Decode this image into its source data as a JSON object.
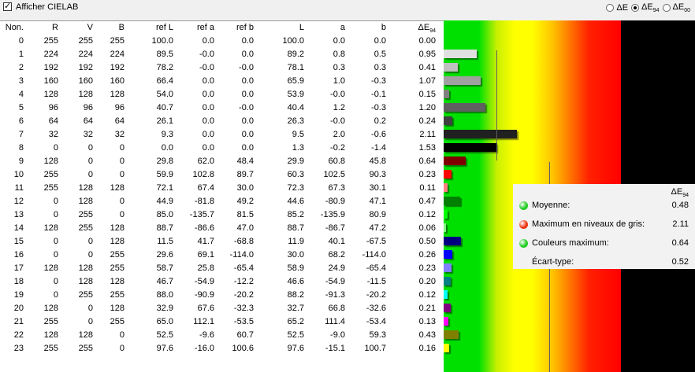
{
  "header": {
    "checkbox_label": "Afficher CIELAB",
    "checkbox_checked": true,
    "radios": [
      {
        "label": "ΔE",
        "checked": false
      },
      {
        "label": "ΔE94",
        "checked": true
      },
      {
        "label": "ΔE00",
        "checked": false
      }
    ]
  },
  "table": {
    "columns": [
      "Non.",
      "R",
      "V",
      "B",
      "ref L",
      "ref a",
      "ref b",
      "L",
      "a",
      "b",
      "ΔE94"
    ],
    "rows": [
      [
        "0",
        "255",
        "255",
        "255",
        "100.0",
        "0.0",
        "0.0",
        "100.0",
        "0.0",
        "0.0",
        "0.00"
      ],
      [
        "1",
        "224",
        "224",
        "224",
        "89.5",
        "-0.0",
        "0.0",
        "89.2",
        "0.8",
        "0.5",
        "0.95"
      ],
      [
        "2",
        "192",
        "192",
        "192",
        "78.2",
        "-0.0",
        "-0.0",
        "78.1",
        "0.3",
        "0.3",
        "0.41"
      ],
      [
        "3",
        "160",
        "160",
        "160",
        "66.4",
        "0.0",
        "0.0",
        "65.9",
        "1.0",
        "-0.3",
        "1.07"
      ],
      [
        "4",
        "128",
        "128",
        "128",
        "54.0",
        "0.0",
        "0.0",
        "53.9",
        "-0.0",
        "-0.1",
        "0.15"
      ],
      [
        "5",
        "96",
        "96",
        "96",
        "40.7",
        "0.0",
        "-0.0",
        "40.4",
        "1.2",
        "-0.3",
        "1.20"
      ],
      [
        "6",
        "64",
        "64",
        "64",
        "26.1",
        "0.0",
        "0.0",
        "26.3",
        "-0.0",
        "0.2",
        "0.24"
      ],
      [
        "7",
        "32",
        "32",
        "32",
        "9.3",
        "0.0",
        "0.0",
        "9.5",
        "2.0",
        "-0.6",
        "2.11"
      ],
      [
        "8",
        "0",
        "0",
        "0",
        "0.0",
        "0.0",
        "0.0",
        "1.3",
        "-0.2",
        "-1.4",
        "1.53"
      ],
      [
        "9",
        "128",
        "0",
        "0",
        "29.8",
        "62.0",
        "48.4",
        "29.9",
        "60.8",
        "45.8",
        "0.64"
      ],
      [
        "10",
        "255",
        "0",
        "0",
        "59.9",
        "102.8",
        "89.7",
        "60.3",
        "102.5",
        "90.3",
        "0.23"
      ],
      [
        "11",
        "255",
        "128",
        "128",
        "72.1",
        "67.4",
        "30.0",
        "72.3",
        "67.3",
        "30.1",
        "0.11"
      ],
      [
        "12",
        "0",
        "128",
        "0",
        "44.9",
        "-81.8",
        "49.2",
        "44.6",
        "-80.9",
        "47.1",
        "0.47"
      ],
      [
        "13",
        "0",
        "255",
        "0",
        "85.0",
        "-135.7",
        "81.5",
        "85.2",
        "-135.9",
        "80.9",
        "0.12"
      ],
      [
        "14",
        "128",
        "255",
        "128",
        "88.7",
        "-86.6",
        "47.0",
        "88.7",
        "-86.7",
        "47.2",
        "0.06"
      ],
      [
        "15",
        "0",
        "0",
        "128",
        "11.5",
        "41.7",
        "-68.8",
        "11.9",
        "40.1",
        "-67.5",
        "0.50"
      ],
      [
        "16",
        "0",
        "0",
        "255",
        "29.6",
        "69.1",
        "-114.0",
        "30.0",
        "68.2",
        "-114.0",
        "0.26"
      ],
      [
        "17",
        "128",
        "128",
        "255",
        "58.7",
        "25.8",
        "-65.4",
        "58.9",
        "24.9",
        "-65.4",
        "0.23"
      ],
      [
        "18",
        "0",
        "128",
        "128",
        "46.7",
        "-54.9",
        "-12.2",
        "46.6",
        "-54.9",
        "-11.5",
        "0.20"
      ],
      [
        "19",
        "0",
        "255",
        "255",
        "88.0",
        "-90.9",
        "-20.2",
        "88.2",
        "-91.3",
        "-20.2",
        "0.12"
      ],
      [
        "20",
        "128",
        "0",
        "128",
        "32.9",
        "67.6",
        "-32.3",
        "32.7",
        "66.8",
        "-32.6",
        "0.21"
      ],
      [
        "21",
        "255",
        "0",
        "255",
        "65.0",
        "112.1",
        "-53.5",
        "65.2",
        "111.4",
        "-53.4",
        "0.13"
      ],
      [
        "22",
        "128",
        "128",
        "0",
        "52.5",
        "-9.6",
        "60.7",
        "52.5",
        "-9.0",
        "59.3",
        "0.43"
      ],
      [
        "23",
        "255",
        "255",
        "0",
        "97.6",
        "-16.0",
        "100.6",
        "97.6",
        "-15.1",
        "100.7",
        "0.16"
      ]
    ]
  },
  "bar_colors": [
    "#ffffff",
    "#e0e0e0",
    "#c0c0c0",
    "#a0a0a0",
    "#808080",
    "#606060",
    "#404040",
    "#202020",
    "#000000",
    "#800000",
    "#ff0000",
    "#ff8080",
    "#008000",
    "#00ff00",
    "#80ff80",
    "#000080",
    "#0000ff",
    "#8080ff",
    "#008080",
    "#00ffff",
    "#800080",
    "#ff00ff",
    "#808000",
    "#ffff00"
  ],
  "stats": {
    "header": "ΔE94",
    "rows": [
      {
        "label": "Moyenne:",
        "value": "0.48",
        "dot": "#22cc22"
      },
      {
        "label": "Maximum en niveaux de gris:",
        "value": "2.11",
        "dot": "#ee3311"
      },
      {
        "label": "Couleurs maximum:",
        "value": "0.64",
        "dot": "#22cc22"
      },
      {
        "label": "Écart-type:",
        "value": "0.52",
        "dot": null
      }
    ]
  }
}
